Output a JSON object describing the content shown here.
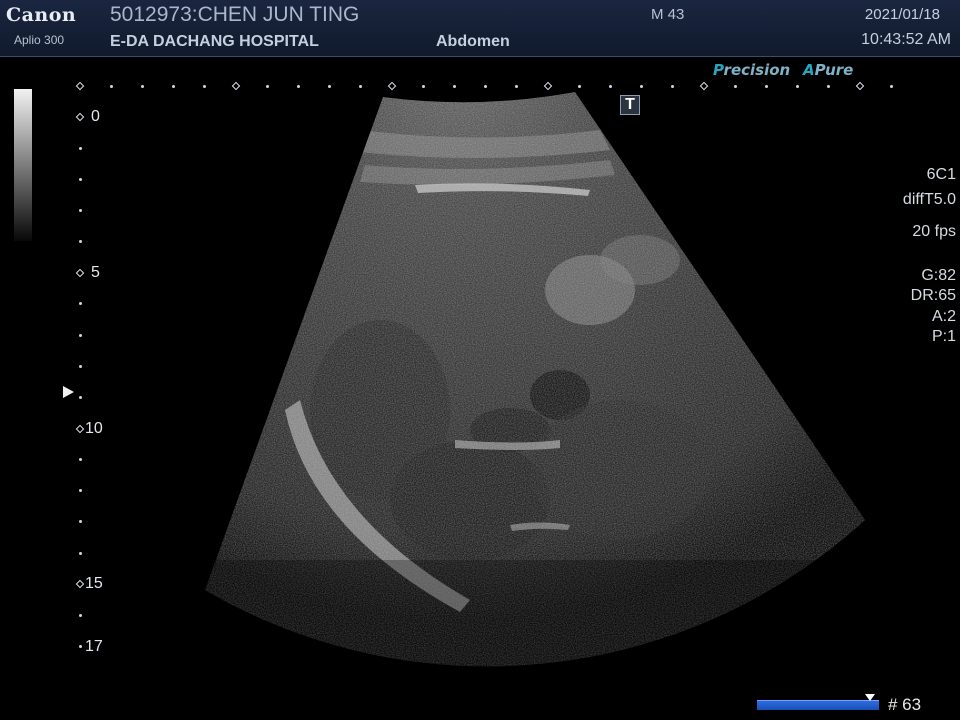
{
  "header": {
    "brand": "Canon",
    "model": "Aplio 300",
    "patient": "5012973:CHEN JUN TING",
    "hospital": "E-DA DACHANG HOSPITAL",
    "exam": "Abdomen",
    "meta": "M 43",
    "date": "2021/01/18",
    "time": "10:43:52 AM"
  },
  "badges": {
    "precision_first": "P",
    "precision_rest": "recision",
    "apure_first": "A",
    "apure_rest": "Pure"
  },
  "t_icon_label": "T",
  "depth_scale": {
    "labels": [
      "0",
      "5",
      "10",
      "15",
      "17"
    ]
  },
  "parameters": {
    "probe": "6C1",
    "mode": "diffT5.0",
    "fps": "20 fps",
    "gain": "G:82",
    "dynamic_range": "DR:65",
    "a": "A:2",
    "p": "P:1"
  },
  "cine": {
    "frame": "# 63"
  },
  "colors": {
    "header_bg": "#1a2640",
    "badge_accent": "#2aa6c0",
    "cine_bar": "#2d6de0"
  }
}
